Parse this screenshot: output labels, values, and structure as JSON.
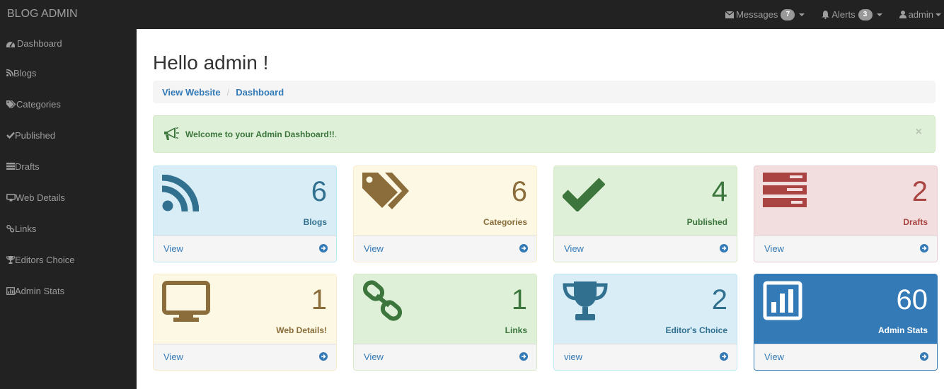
{
  "topbar": {
    "brand": "BLOG ADMIN",
    "messages": {
      "label": "Messages",
      "count": "7",
      "icon": "envelope-icon"
    },
    "alerts": {
      "label": "Alerts",
      "count": "3",
      "icon": "bell-icon"
    },
    "user": {
      "label": "admin",
      "icon": "user-icon"
    }
  },
  "sidebar": {
    "items": [
      {
        "label": "Dashboard",
        "icon": "dashboard-icon"
      },
      {
        "label": "Blogs",
        "icon": "rss-icon"
      },
      {
        "label": "Categories",
        "icon": "tags-icon"
      },
      {
        "label": "Published",
        "icon": "check-icon"
      },
      {
        "label": "Drafts",
        "icon": "list-icon"
      },
      {
        "label": "Web Details",
        "icon": "desktop-icon"
      },
      {
        "label": "Links",
        "icon": "link-icon"
      },
      {
        "label": "Editors Choice",
        "icon": "trophy-icon"
      },
      {
        "label": "Admin Stats",
        "icon": "bar-chart-icon"
      }
    ]
  },
  "main": {
    "title": "Hello admin !",
    "breadcrumb": {
      "home": "View Website",
      "separator": "/",
      "current": "Dashboard"
    },
    "alert": {
      "text": "Welcome to your Admin Dashboard!!",
      "suffix": ".",
      "close": "×",
      "icon": "bullhorn-icon"
    },
    "panels": [
      {
        "count": "6",
        "label": "Blogs",
        "view": "View",
        "icon": "rss-icon",
        "style": "info"
      },
      {
        "count": "6",
        "label": "Categories",
        "view": "View",
        "icon": "tags-icon",
        "style": "warning"
      },
      {
        "count": "4",
        "label": "Published",
        "view": "View",
        "icon": "check-icon",
        "style": "success"
      },
      {
        "count": "2",
        "label": "Drafts",
        "view": "View",
        "icon": "list-icon",
        "style": "danger"
      },
      {
        "count": "1",
        "label": "Web Details!",
        "view": "View",
        "icon": "desktop-icon",
        "style": "warning"
      },
      {
        "count": "1",
        "label": "Links",
        "view": "View",
        "icon": "link-icon",
        "style": "success"
      },
      {
        "count": "2",
        "label": "Editor's Choice",
        "view": "view",
        "icon": "trophy-icon",
        "style": "info"
      },
      {
        "count": "60",
        "label": "Admin Stats",
        "view": "View",
        "icon": "bar-chart-icon",
        "style": "primary"
      }
    ]
  },
  "colors": {
    "navbar": "#222222",
    "link": "#337ab7",
    "info": "#31708f",
    "warning": "#8a6d3b",
    "success": "#3c763d",
    "danger": "#a94442",
    "primary": "#337ab7"
  }
}
